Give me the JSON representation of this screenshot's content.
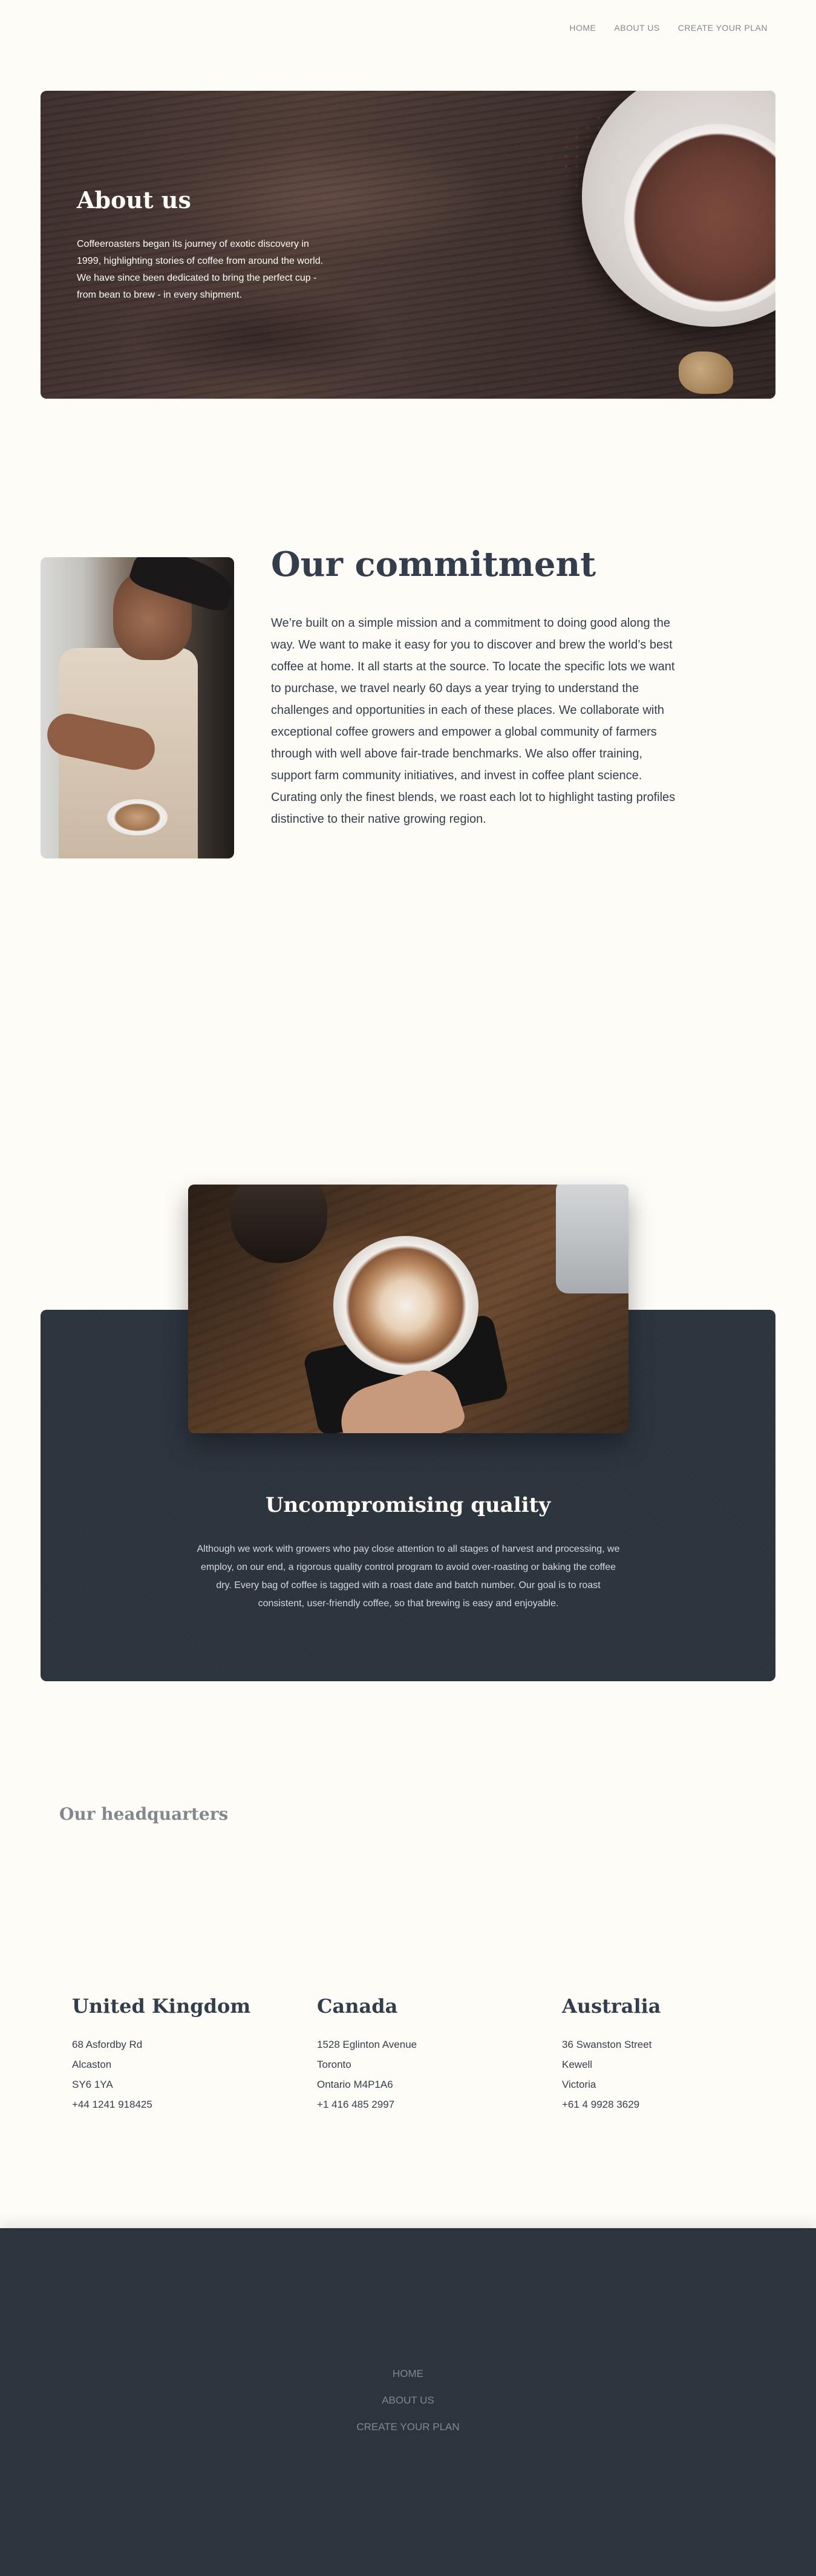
{
  "nav": {
    "items": [
      "HOME",
      "ABOUT US",
      "CREATE YOUR PLAN"
    ]
  },
  "hero": {
    "title": "About us",
    "text": "Coffeeroasters began its journey of exotic discovery in 1999, highlighting stories of coffee from around the world. We have since been dedicated to bring the perfect cup - from bean to brew - in every shipment."
  },
  "commitment": {
    "title": "Our commitment",
    "text": "We’re built on a simple mission and a commitment to doing good along the way. We want to make it easy for you to discover and brew the world’s best coffee at home. It all starts at the source. To locate the specific lots we want to purchase, we travel nearly 60 days a year trying to understand the challenges and opportunities in each of these places. We collaborate with exceptional coffee growers and empower a global community of farmers through with well above fair-trade benchmarks. We also offer training, support farm community initiatives, and invest in coffee plant science. Curating only the finest blends, we roast each lot to highlight tasting profiles distinctive to their native growing region."
  },
  "quality": {
    "title": "Uncompromising quality",
    "text": "Although we work with growers who pay close attention to all stages of harvest and processing, we employ, on our end, a rigorous quality control program to avoid over-roasting or baking the coffee dry. Every bag of coffee is tagged with a roast date and batch number. Our goal is to roast consistent, user-friendly coffee, so that brewing is easy and enjoyable."
  },
  "headquarters": {
    "title": "Our headquarters",
    "locations": [
      {
        "country": "United Kingdom",
        "line1": "68 Asfordby Rd",
        "line2": "Alcaston",
        "line3": "SY6 1YA",
        "phone": "+44 1241 918425"
      },
      {
        "country": "Canada",
        "line1": "1528 Eglinton Avenue",
        "line2": "Toronto",
        "line3": "Ontario M4P1A6",
        "phone": "+1 416 485 2997"
      },
      {
        "country": "Australia",
        "line1": "36 Swanston Street",
        "line2": "Kewell",
        "line3": "Victoria",
        "phone": "+61 4 9928 3629"
      }
    ]
  },
  "footer": {
    "items": [
      "HOME",
      "ABOUT US",
      "CREATE YOUR PLAN"
    ]
  },
  "colors": {
    "background": "#fefcf7",
    "dark_navy": "#2c343e",
    "text": "#333d4b",
    "muted": "#83888f"
  }
}
